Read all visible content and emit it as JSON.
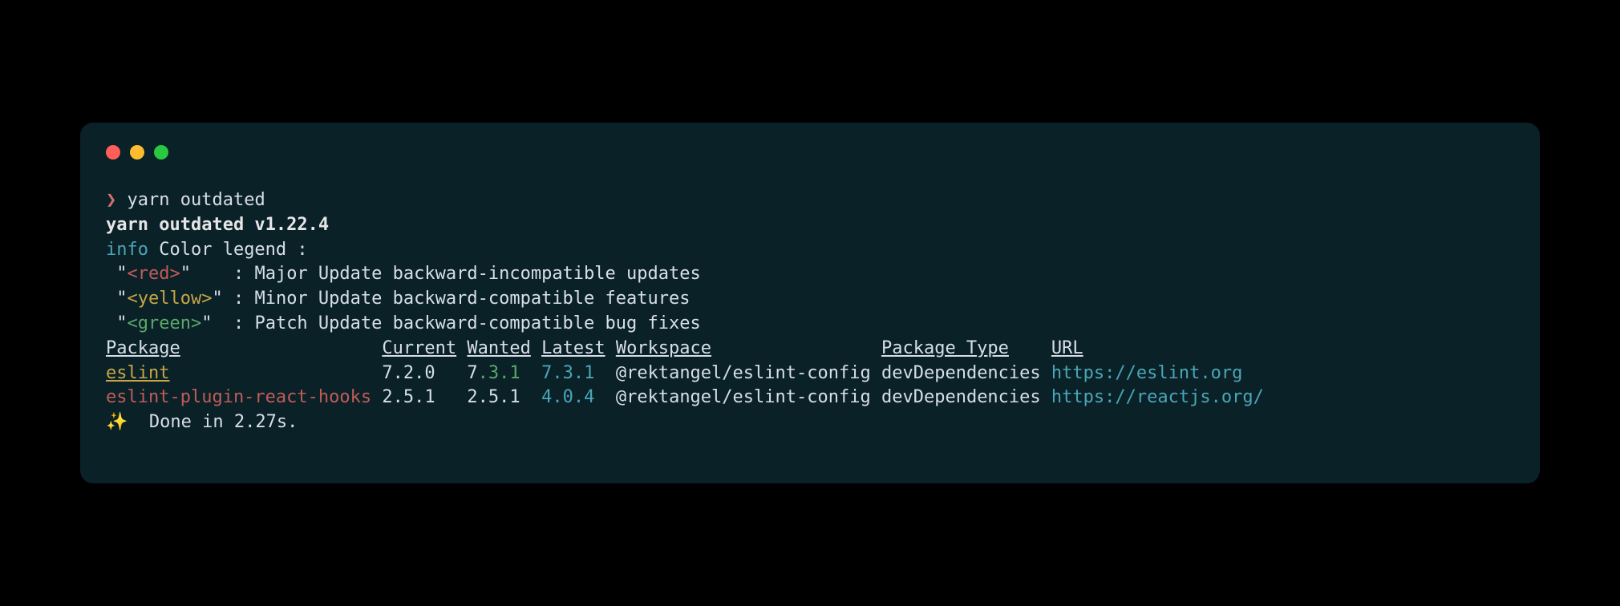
{
  "prompt": {
    "caret": "❯",
    "command": "yarn outdated"
  },
  "versionLine": "yarn outdated v1.22.4",
  "infoLabel": "info",
  "infoText": " Color legend :",
  "legend": {
    "red": {
      "tag": "<red>",
      "desc": "Major Update backward-incompatible updates"
    },
    "yellow": {
      "tag": "<yellow>",
      "desc": "Minor Update backward-compatible features"
    },
    "green": {
      "tag": "<green>",
      "desc": "Patch Update backward-compatible bug fixes"
    }
  },
  "headers": {
    "package": "Package",
    "current": "Current",
    "wanted": "Wanted",
    "latest": "Latest",
    "workspace": "Workspace",
    "packageType": "Package Type",
    "url": "URL"
  },
  "rows": [
    {
      "package": "eslint",
      "packageColor": "yellow-underline",
      "current": "7.2.0",
      "wanted_prefix": "7",
      "wanted_colored": ".3.1",
      "latest": "7.3.1",
      "workspace": "@rektangel/eslint-config",
      "packageType": "devDependencies",
      "url": "https://eslint.org"
    },
    {
      "package": "eslint-plugin-react-hooks",
      "packageColor": "red",
      "current": "2.5.1",
      "wanted_prefix": "2.5.1",
      "wanted_colored": "",
      "latest": "4.0.4",
      "workspace": "@rektangel/eslint-config",
      "packageType": "devDependencies",
      "url": "https://reactjs.org/"
    }
  ],
  "done": {
    "sparkle": "✨",
    "text": "  Done in 2.27s."
  }
}
